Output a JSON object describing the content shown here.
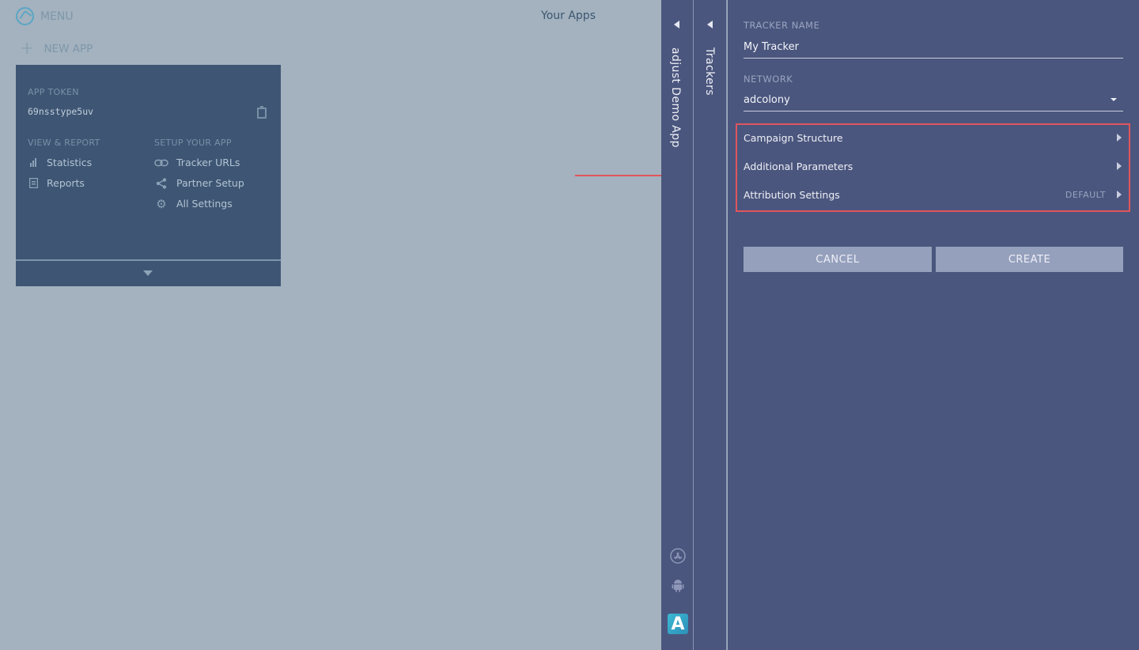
{
  "topbar": {
    "menu_label": "MENU",
    "page_title": "Your Apps",
    "new_app_label": "NEW APP"
  },
  "app_card": {
    "token_label": "APP TOKEN",
    "token_value": "69nsstype5uv",
    "view_report": {
      "heading": "VIEW & REPORT",
      "items": [
        {
          "label": "Statistics",
          "icon": "bar-chart-icon"
        },
        {
          "label": "Reports",
          "icon": "report-icon"
        }
      ]
    },
    "setup": {
      "heading": "SETUP YOUR APP",
      "items": [
        {
          "label": "Tracker URLs",
          "icon": "link-icon"
        },
        {
          "label": "Partner Setup",
          "icon": "share-icon"
        },
        {
          "label": "All Settings",
          "icon": "gear-icon"
        }
      ]
    }
  },
  "panels": {
    "app_name": "adjust Demo App",
    "trackers_title": "Trackers",
    "brand_letter": "A"
  },
  "form": {
    "tracker_name_label": "TRACKER NAME",
    "tracker_name_value": "My Tracker",
    "network_label": "NETWORK",
    "network_value": "adcolony",
    "sections": [
      {
        "label": "Campaign Structure",
        "badge": ""
      },
      {
        "label": "Additional Parameters",
        "badge": ""
      },
      {
        "label": "Attribution Settings",
        "badge": "DEFAULT"
      }
    ],
    "cancel_label": "CANCEL",
    "create_label": "CREATE"
  },
  "colors": {
    "background": "#a3b2be",
    "card": "#3e5674",
    "panel": "#4b567e",
    "button": "#95a0bd",
    "highlight": "#e0555c",
    "accent": "#3bb9d3"
  }
}
